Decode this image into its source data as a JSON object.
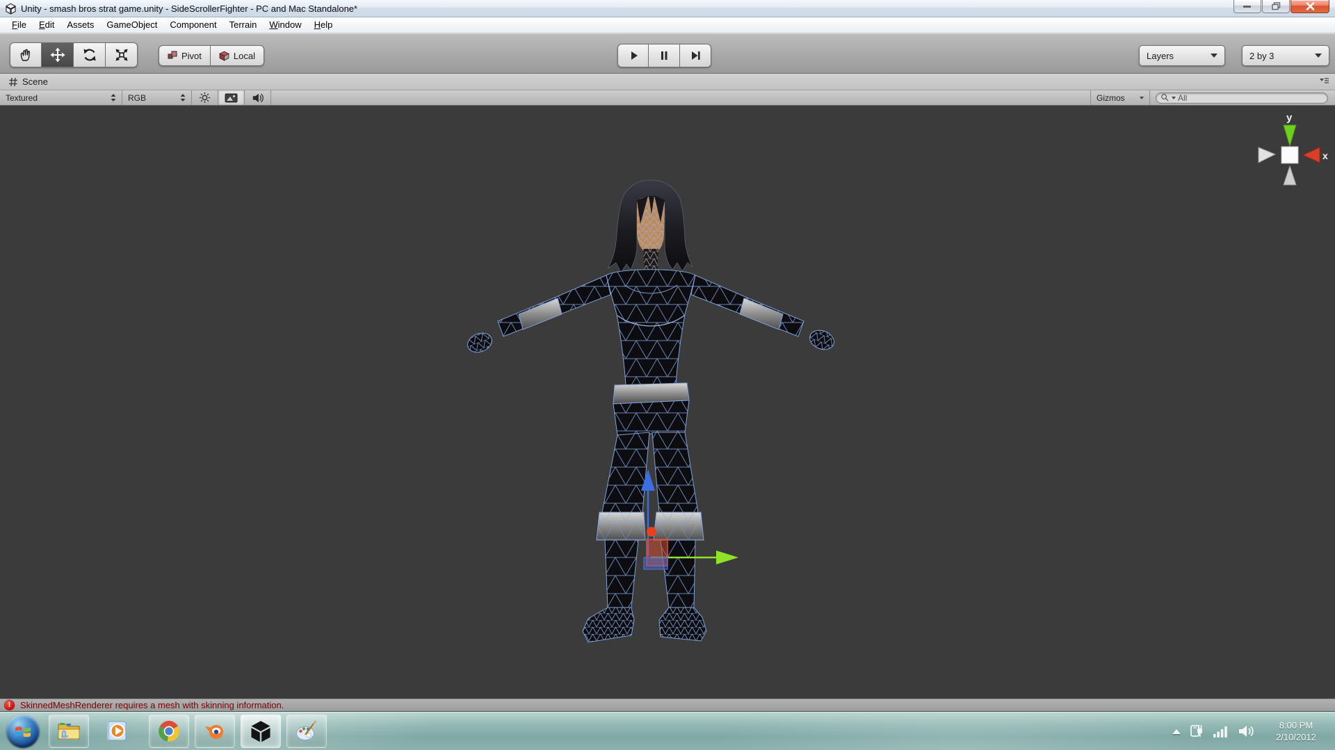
{
  "window": {
    "title": "Unity - smash bros strat game.unity - SideScrollerFighter - PC and Mac Standalone*"
  },
  "menubar": {
    "items": [
      "File",
      "Edit",
      "Assets",
      "GameObject",
      "Component",
      "Terrain",
      "Window",
      "Help"
    ]
  },
  "toolbar": {
    "pivot_label": "Pivot",
    "local_label": "Local",
    "layers_label": "Layers",
    "layout_label": "2 by 3"
  },
  "scene_panel": {
    "tab_label": "Scene",
    "draw_mode": "Textured",
    "color_mode": "RGB",
    "gizmos_label": "Gizmos",
    "search_value": "All"
  },
  "axis_gizmo": {
    "y_label": "y",
    "x_label": "x"
  },
  "statusbar": {
    "icon_glyph": "!",
    "message": "SkinnedMeshRenderer requires a mesh with skinning information."
  },
  "taskbar": {
    "apps": [
      "start-orb",
      "windows-explorer",
      "windows-media-player",
      "google-chrome",
      "blender",
      "unity",
      "paint"
    ],
    "tray_icons": [
      "hidden-icons-arrow",
      "power-plug",
      "network-signal",
      "volume-speaker"
    ],
    "clock_time": "8:00 PM",
    "clock_date": "2/10/2012"
  },
  "colors": {
    "viewport_bg": "#3b3b3b",
    "wireframe_blue": "#7fa3d8",
    "error_red": "#7c0000",
    "taskbar_teal": "#8db1ad",
    "axis_y_green": "#6fce1f",
    "axis_x_red": "#d8402a",
    "gizmo_green": "#8ee32a",
    "gizmo_blue": "#3b6fe0",
    "gizmo_red": "#e8411f"
  }
}
